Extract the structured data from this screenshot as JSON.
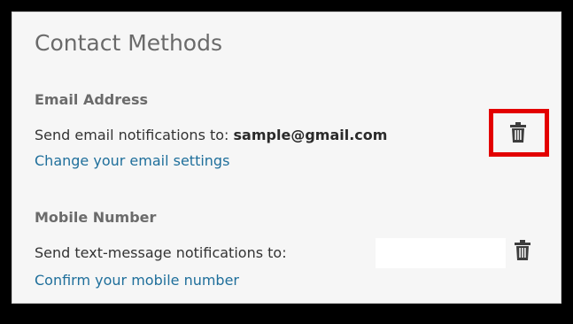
{
  "panel": {
    "title": "Contact Methods"
  },
  "email": {
    "heading": "Email Address",
    "prefix": "Send email notifications to: ",
    "value": "sample@gmail.com",
    "link_label": "Change your email settings",
    "delete_icon": "trash-icon",
    "highlighted": true
  },
  "mobile": {
    "heading": "Mobile Number",
    "prefix": "Send text-message notifications to:",
    "link_label": "Confirm your mobile number",
    "delete_icon": "trash-icon"
  },
  "colors": {
    "link": "#1f6f9b",
    "highlight": "#e30000",
    "heading": "#6b6b6b"
  }
}
